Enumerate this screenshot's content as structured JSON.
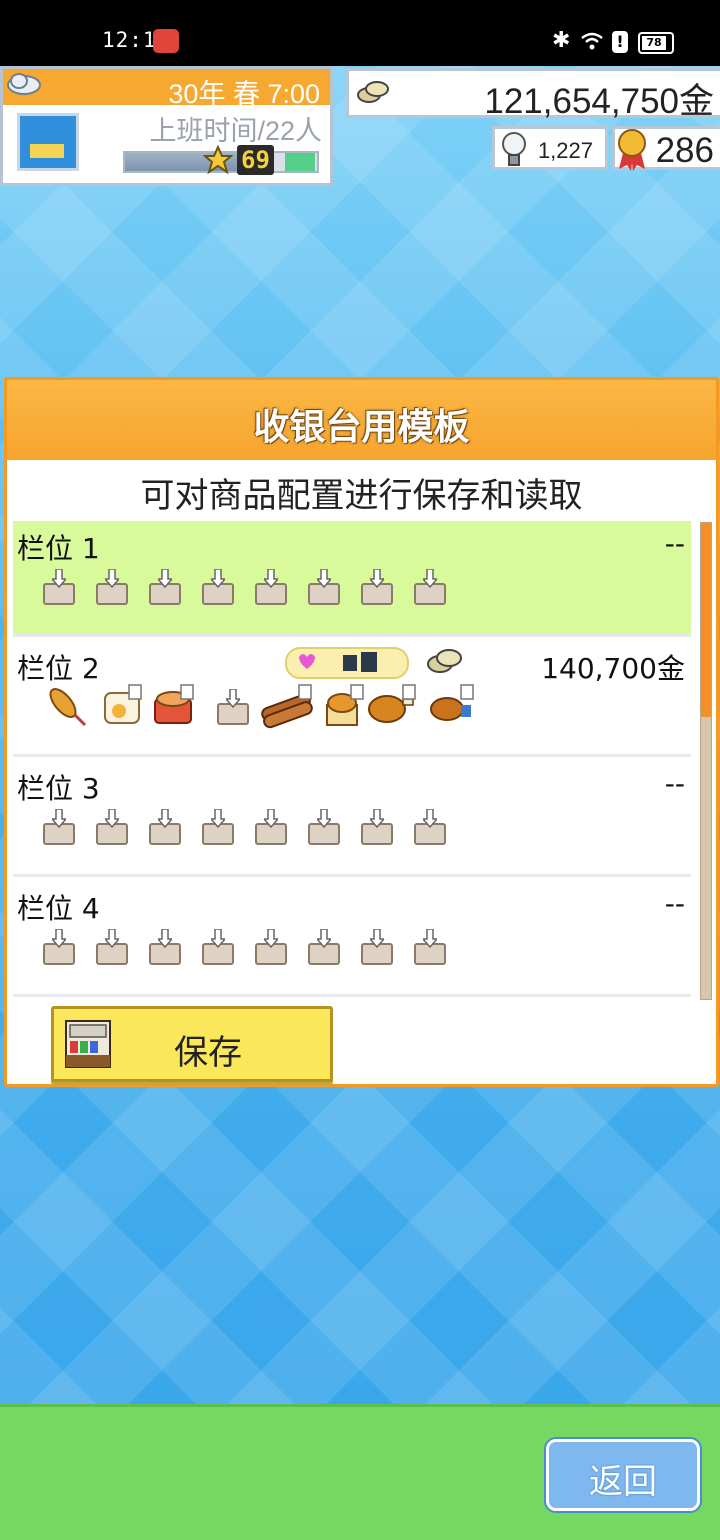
{
  "status_bar": {
    "time": "12:14",
    "battery": "78",
    "icons": [
      "notification-icon",
      "bluetooth-icon",
      "wifi-icon",
      "alert-icon",
      "battery-icon"
    ]
  },
  "hud": {
    "date": "30年 春 7:00",
    "shift": "上班时间/22人",
    "level": "69",
    "money": "121,654,750金",
    "ideas": "1,227",
    "medals": "286"
  },
  "panel": {
    "title": "收银台用模板",
    "subtitle": "可对商品配置进行保存和读取",
    "slots": [
      {
        "name": "栏位 1",
        "price": "--",
        "items": "empty",
        "selected": true
      },
      {
        "name": "栏位 2",
        "price": "140,700金",
        "items": "filled",
        "selected": false
      },
      {
        "name": "栏位 3",
        "price": "--",
        "items": "empty",
        "selected": false
      },
      {
        "name": "栏位 4",
        "price": "--",
        "items": "empty",
        "selected": false
      }
    ],
    "save_label": "保存"
  },
  "back_label": "返回",
  "colors": {
    "panel_header": "#f7a831",
    "selected_slot": "#d9fa9b",
    "save_button": "#fbe85a",
    "bottom_bar": "#75d860",
    "back_button": "#7fb8ee"
  }
}
